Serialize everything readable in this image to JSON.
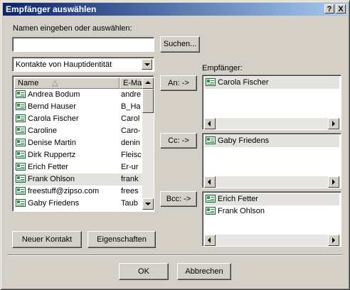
{
  "window": {
    "title": "Empfänger auswählen",
    "help_label": "?",
    "close_label": "X"
  },
  "search": {
    "prompt_label": "Namen eingeben oder auswählen:",
    "input_value": "",
    "search_button_label": "Suchen..."
  },
  "address_book": {
    "selected": "Kontakte von Hauptidentität"
  },
  "contacts_list": {
    "columns": [
      "Name",
      "E-Mail"
    ],
    "rows": [
      {
        "name": "Andrea Bodum",
        "email": "andre",
        "selected": false
      },
      {
        "name": "Bernd Hauser",
        "email": "B_Ha",
        "selected": false
      },
      {
        "name": "Carola Fischer",
        "email": "Carol",
        "selected": false
      },
      {
        "name": "Caroline",
        "email": "Caro-",
        "selected": false
      },
      {
        "name": "Denise Martin",
        "email": "denin",
        "selected": false
      },
      {
        "name": "Dirk Ruppertz",
        "email": "Fleisc",
        "selected": false
      },
      {
        "name": "Erich Fetter",
        "email": "Er-ur",
        "selected": false
      },
      {
        "name": "Frank Ohlson",
        "email": "frank",
        "selected": true
      },
      {
        "name": "freestuff@zipso.com",
        "email": "frees",
        "selected": false
      },
      {
        "name": "Gaby Friedens",
        "email": "Taub",
        "selected": false
      }
    ]
  },
  "recipients": {
    "label": "Empfänger:",
    "to": {
      "button_label": "An: ->",
      "names": [
        "Carola Fischer"
      ]
    },
    "cc": {
      "button_label": "Cc: ->",
      "names": [
        "Gaby Friedens"
      ]
    },
    "bcc": {
      "button_label": "Bcc: ->",
      "names": [
        "Erich Fetter",
        "Frank Ohlson"
      ]
    }
  },
  "buttons": {
    "new_contact": "Neuer Kontakt",
    "properties": "Eigenschaften",
    "ok": "OK",
    "cancel": "Abbrechen"
  }
}
